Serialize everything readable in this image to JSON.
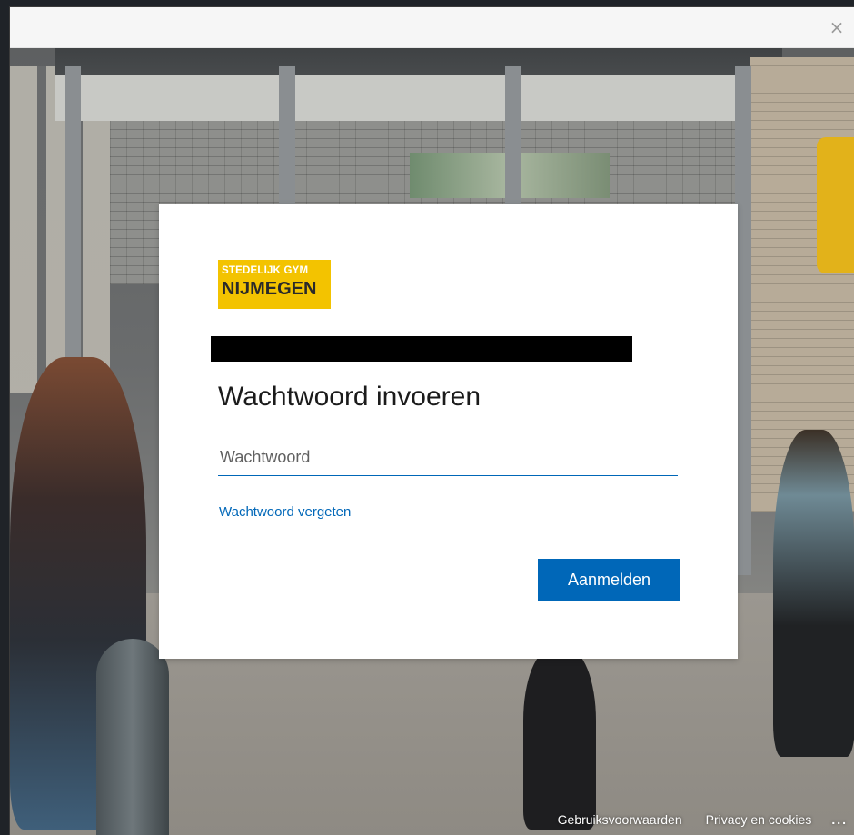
{
  "window": {
    "close_glyph": "×"
  },
  "dialog": {
    "logo": {
      "line1": "STEDELIJK GYM",
      "line2": "NIJMEGEN",
      "color": "#f3c300"
    },
    "heading": "Wachtwoord invoeren",
    "password": {
      "placeholder": "Wachtwoord",
      "value": ""
    },
    "forgot_link": "Wachtwoord vergeten",
    "signin_button": "Aanmelden",
    "accent_color": "#0067b8"
  },
  "footer": {
    "terms_link": "Gebruiksvoorwaarden",
    "privacy_link": "Privacy en cookies",
    "more_glyph": "..."
  }
}
